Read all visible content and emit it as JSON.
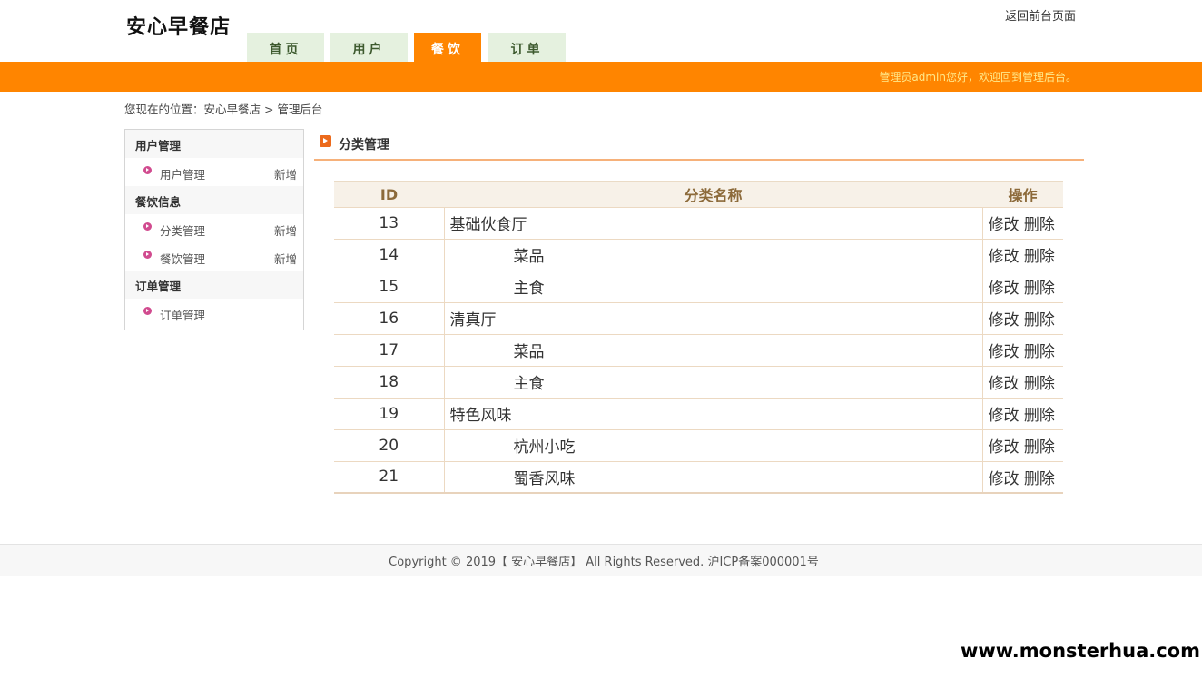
{
  "header": {
    "logo": "安心早餐店",
    "top_link": "返回前台页面",
    "nav": [
      {
        "label": "首页",
        "active": false
      },
      {
        "label": "用户",
        "active": false
      },
      {
        "label": "餐饮",
        "active": true
      },
      {
        "label": "订单",
        "active": false
      }
    ],
    "welcome": "管理员admin您好，欢迎回到管理后台。"
  },
  "breadcrumb": "您现在的位置：安心早餐店 > 管理后台",
  "sidebar": {
    "groups": [
      {
        "title": "用户管理",
        "items": [
          {
            "label": "用户管理",
            "action": "新增"
          }
        ]
      },
      {
        "title": "餐饮信息",
        "items": [
          {
            "label": "分类管理",
            "action": "新增"
          },
          {
            "label": "餐饮管理",
            "action": "新增"
          }
        ]
      },
      {
        "title": "订单管理",
        "items": [
          {
            "label": "订单管理",
            "action": ""
          }
        ]
      }
    ]
  },
  "content": {
    "title": "分类管理",
    "table": {
      "headers": [
        "ID",
        "分类名称",
        "操作"
      ],
      "edit_label": "修改",
      "delete_label": "删除",
      "rows": [
        {
          "id": "13",
          "name": "基础伙食厅",
          "child": false
        },
        {
          "id": "14",
          "name": "菜品",
          "child": true
        },
        {
          "id": "15",
          "name": "主食",
          "child": true
        },
        {
          "id": "16",
          "name": "清真厅",
          "child": false
        },
        {
          "id": "17",
          "name": "菜品",
          "child": true
        },
        {
          "id": "18",
          "name": "主食",
          "child": true
        },
        {
          "id": "19",
          "name": "特色风味",
          "child": false
        },
        {
          "id": "20",
          "name": "杭州小吃",
          "child": true
        },
        {
          "id": "21",
          "name": "蜀香风味",
          "child": true
        }
      ]
    }
  },
  "footer": "Copyright © 2019【 安心早餐店】 All Rights Reserved. 沪ICP备案000001号",
  "watermark": "www.monsterhua.com",
  "colors": {
    "accent": "#ff8500",
    "nav_tab": "#e5f1df",
    "welcome_text": "#ffe98a",
    "table_header": "#f7f1e8"
  }
}
